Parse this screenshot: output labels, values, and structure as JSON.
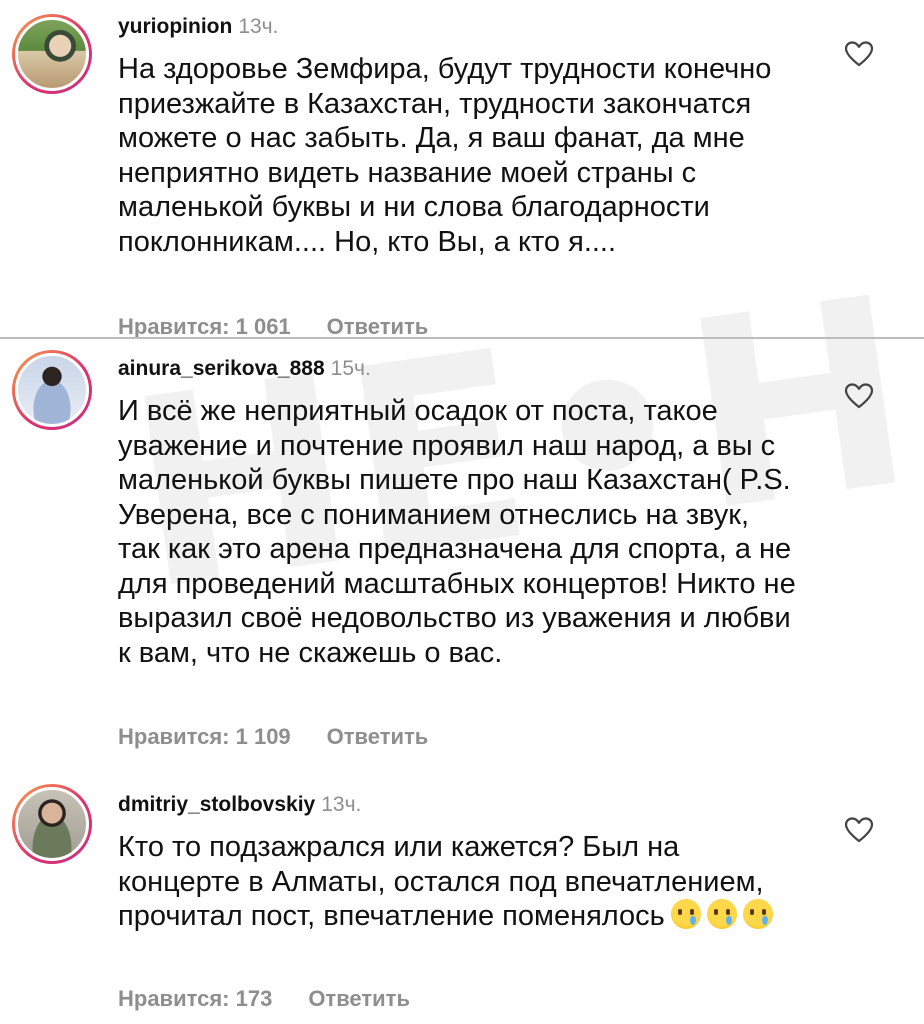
{
  "comments": [
    {
      "username": "yuriopinion",
      "time": "13ч.",
      "text": "На здоровье Земфира, будут трудности конечно приезжайте в Казахстан, трудности закончатся можете о нас забыть. Да, я ваш фанат, да мне неприятно видеть название моей страны с маленькой буквы и ни слова благодарности поклонникам.... Но, кто Вы, а кто я....",
      "likes": "Нравится: 1 061",
      "reply": "Ответить"
    },
    {
      "username": "ainura_serikova_888",
      "time": "15ч.",
      "text": "И всё же неприятный осадок от поста, такое уважение и почтение проявил наш народ, а вы с маленькой буквы пишете про наш Казахстан( P.S. Уверена, все с пониманием отнеслись на звук, так как это арена предназначена для спорта, а не для проведений масштабных концертов! Никто не выразил своё недовольство из уважения и любви к вам, что не скажешь о вас.",
      "likes": "Нравится: 1 109",
      "reply": "Ответить"
    },
    {
      "username": "dmitriy_stolbovskiy",
      "time": "13ч.",
      "text": "Кто то подзажрался или кажется? Был на концерте в Алматы, остался под впечатлением, прочитал пост, впечатление поменялось",
      "emojis": [
        "crying-face",
        "crying-face",
        "crying-face"
      ],
      "likes": "Нравится: 173",
      "reply": "Ответить"
    }
  ],
  "watermark": "НЕ•НЛ",
  "colors": {
    "text": "#111111",
    "secondary": "#8e8e8e",
    "divider": "#bdbdbd",
    "story_ring_start": "#f9a24a",
    "story_ring_end": "#c13584"
  }
}
